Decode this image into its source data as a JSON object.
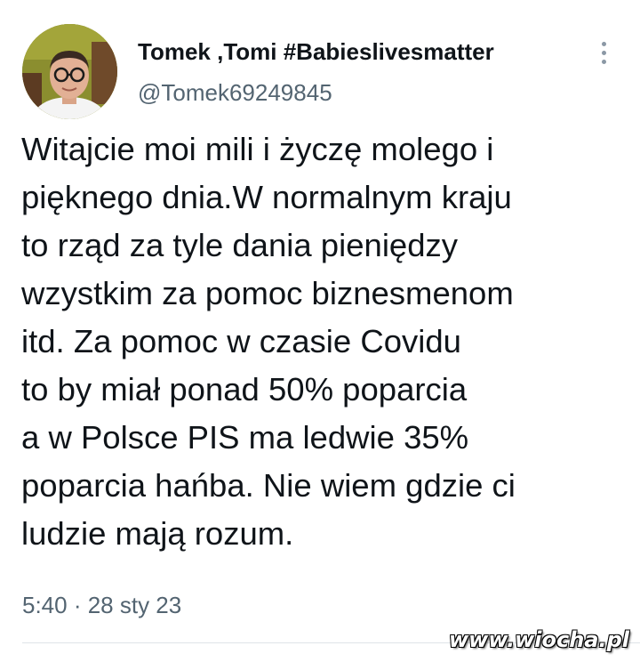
{
  "tweet": {
    "author": {
      "display_name": "Tomek ,Tomi #Babieslivesmatter",
      "handle": "@Tomek69249845",
      "avatar_icon": "profile-photo"
    },
    "more_icon": "more-vertical-icon",
    "text_lines": [
      "Witajcie moi mili i życzę molego i",
      "pięknego dnia.W normalnym kraju",
      "to rząd za tyle dania pieniędzy",
      "wzystkim za pomoc biznesmenom",
      "itd. Za pomoc w czasie Covidu",
      "to by miał ponad 50% poparcia",
      "a w Polsce PIS ma ledwie 35%",
      "poparcia hańba. Nie wiem gdzie ci",
      "ludzie mają rozum."
    ],
    "timestamp": "5:40 · 28 sty 23"
  },
  "watermark": "www.wiocha.pl",
  "colors": {
    "text": "#0f1419",
    "secondary": "#536471",
    "divider": "#dfe4e8"
  }
}
